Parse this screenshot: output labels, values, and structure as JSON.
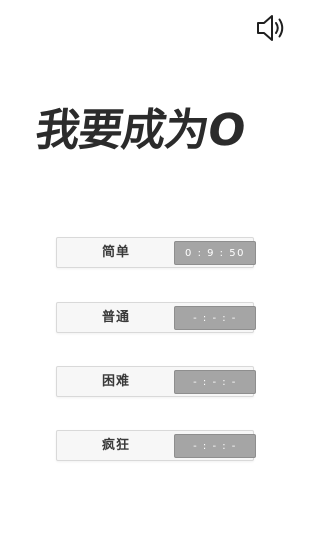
{
  "header": {
    "sound_icon": "speaker-volume-icon"
  },
  "title": "我要成为O",
  "levels": [
    {
      "label": "简单",
      "best_time": "0 : 9 : 50"
    },
    {
      "label": "普通",
      "best_time": "- : - : -"
    },
    {
      "label": "困难",
      "best_time": "- : - : -"
    },
    {
      "label": "疯狂",
      "best_time": "- : - : -"
    }
  ],
  "colors": {
    "title": "#2b2b2b",
    "row_background": "#f7f7f7",
    "time_background": "#a5a5a5",
    "time_text": "#ffffff"
  }
}
